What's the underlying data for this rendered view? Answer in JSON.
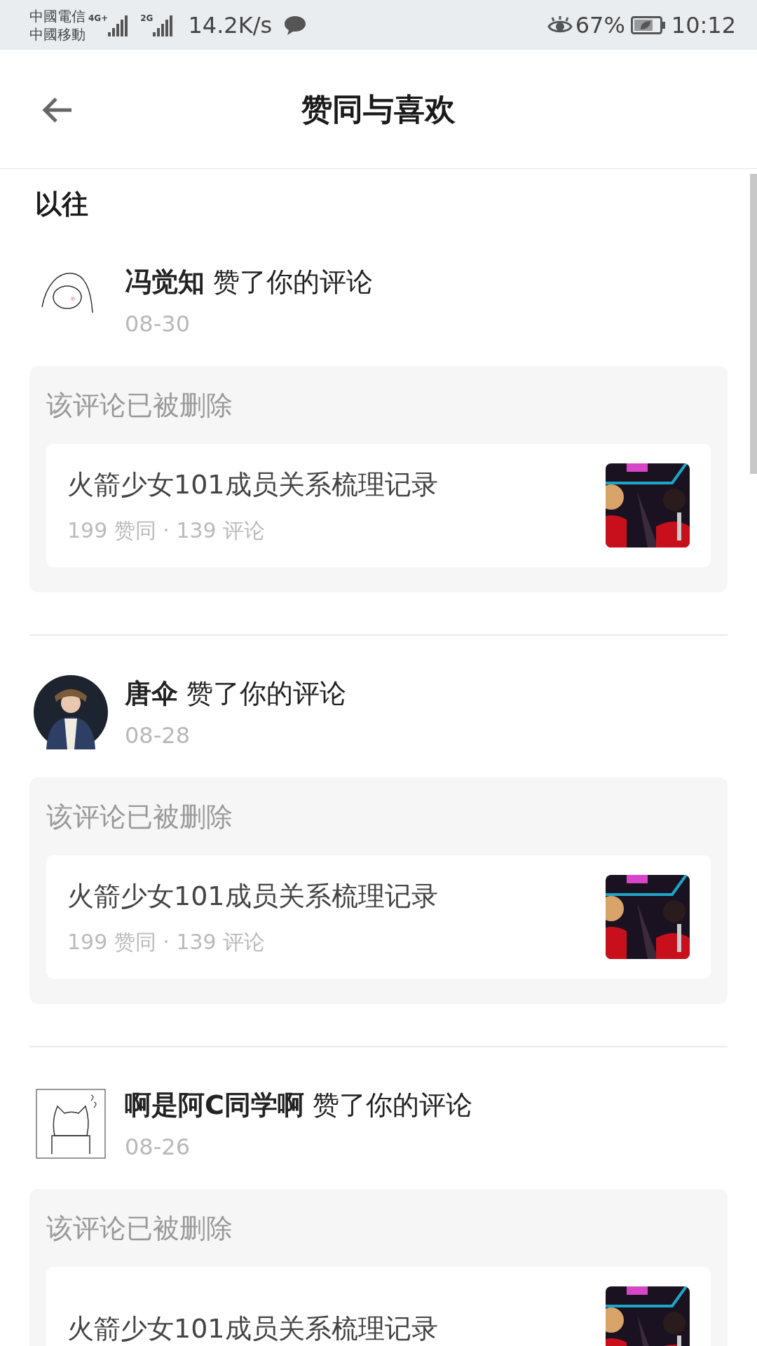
{
  "status_bar": {
    "carriers": [
      "中國電信",
      "中國移動"
    ],
    "networks": [
      "4G+",
      "2G"
    ],
    "speed": "14.2K/s",
    "battery": "67%",
    "time": "10:12"
  },
  "header": {
    "title": "赞同与喜欢"
  },
  "section_title": "以往",
  "notifications": [
    {
      "avatar": {
        "kind": "doodle"
      },
      "text": "**冯觉知** 赞了你的评论",
      "date": "08-30",
      "note": "该评论已被删除",
      "post": {
        "title": "火箭少女101成员关系梳理记录",
        "stats": "199 赞同 · 139 评论"
      }
    },
    {
      "text": "**唐伞** 赞了你的评论",
      "date": "08-28",
      "note": "该评论已被删除",
      "post": {
        "title": "火箭少女101成员关系梳理记录",
        "stats": "199 赞同 · 139 评论"
      }
    },
    {
      "avatar": {
        "kind": "cat"
      },
      "text": "**啊是阿C同学啊** 赞了你的评论",
      "date": "08-26",
      "note": "该评论已被删除",
      "post": {
        "title": "火箭少女101成员关系梳理记录"
      }
    }
  ]
}
